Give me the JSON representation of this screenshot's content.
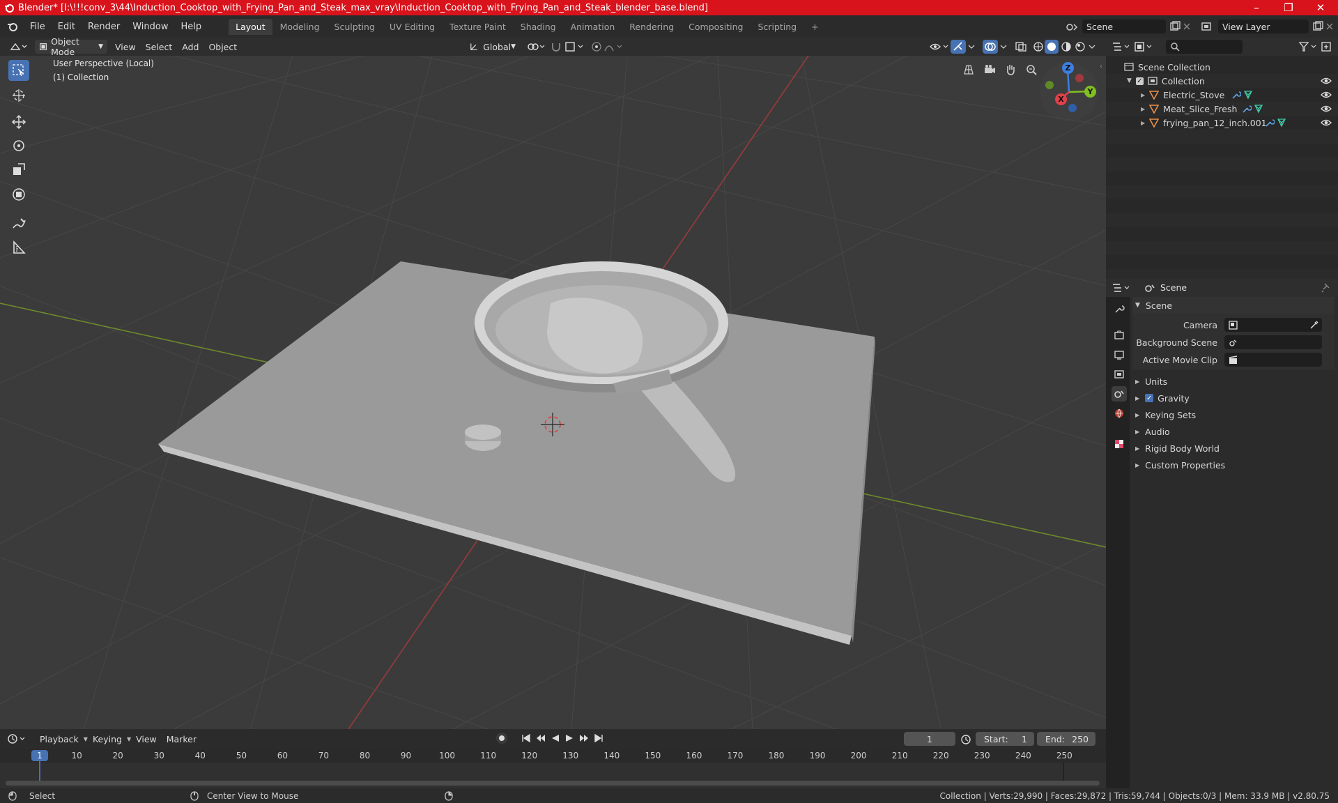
{
  "window": {
    "title": "Blender* [I:\\!!!conv_3\\44\\Induction_Cooktop_with_Frying_Pan_and_Steak_max_vray\\Induction_Cooktop_with_Frying_Pan_and_Steak_blender_base.blend]",
    "minimize": "–",
    "maximize": "❐",
    "close": "✕"
  },
  "menu": [
    "File",
    "Edit",
    "Render",
    "Window",
    "Help"
  ],
  "workspaces": [
    "Layout",
    "Modeling",
    "Sculpting",
    "UV Editing",
    "Texture Paint",
    "Shading",
    "Animation",
    "Rendering",
    "Compositing",
    "Scripting"
  ],
  "active_workspace": "Layout",
  "add_workspace": "+",
  "scene_selector": "Scene",
  "view_layer": "View Layer",
  "viewport_header": {
    "mode": "Object Mode",
    "menus": [
      "View",
      "Select",
      "Add",
      "Object"
    ],
    "orientation": "Global"
  },
  "viewport": {
    "perspective": "User Perspective (Local)",
    "collection": "(1) Collection",
    "gizmo": {
      "x": "X",
      "y": "Y",
      "z": "Z"
    }
  },
  "outliner": {
    "root": "Scene Collection",
    "collection": "Collection",
    "objects": [
      "Electric_Stove",
      "Meat_Slice_Fresh",
      "frying_pan_12_inch.001"
    ]
  },
  "properties": {
    "context": "Scene",
    "panel": "Scene",
    "fields": [
      {
        "label": "Camera",
        "value": ""
      },
      {
        "label": "Background Scene",
        "value": ""
      },
      {
        "label": "Active Movie Clip",
        "value": ""
      }
    ],
    "sections": [
      "Units",
      "Gravity",
      "Keying Sets",
      "Audio",
      "Rigid Body World",
      "Custom Properties"
    ],
    "gravity_enabled": true
  },
  "timeline": {
    "menus": [
      "Playback",
      "Keying",
      "View",
      "Marker"
    ],
    "current_frame": "1",
    "start_label": "Start:",
    "start": "1",
    "end_label": "End:",
    "end": "250",
    "ticks": [
      "1",
      "10",
      "20",
      "30",
      "40",
      "50",
      "60",
      "70",
      "80",
      "90",
      "100",
      "110",
      "120",
      "130",
      "140",
      "150",
      "160",
      "170",
      "180",
      "190",
      "200",
      "210",
      "220",
      "230",
      "240",
      "250"
    ]
  },
  "statusbar": {
    "select": "Select",
    "center": "Center View to Mouse",
    "stats": "Collection | Verts:29,990 | Faces:29,872 | Tris:59,744 | Objects:0/3 | Mem: 33.9 MB | v2.80.75"
  },
  "colors": {
    "titlebar": "#d8131c",
    "accent": "#4772b3",
    "x_axis": "#e0404a",
    "y_axis": "#80c020",
    "z_axis": "#3d7fe0",
    "object_icon": "#e8904a"
  }
}
